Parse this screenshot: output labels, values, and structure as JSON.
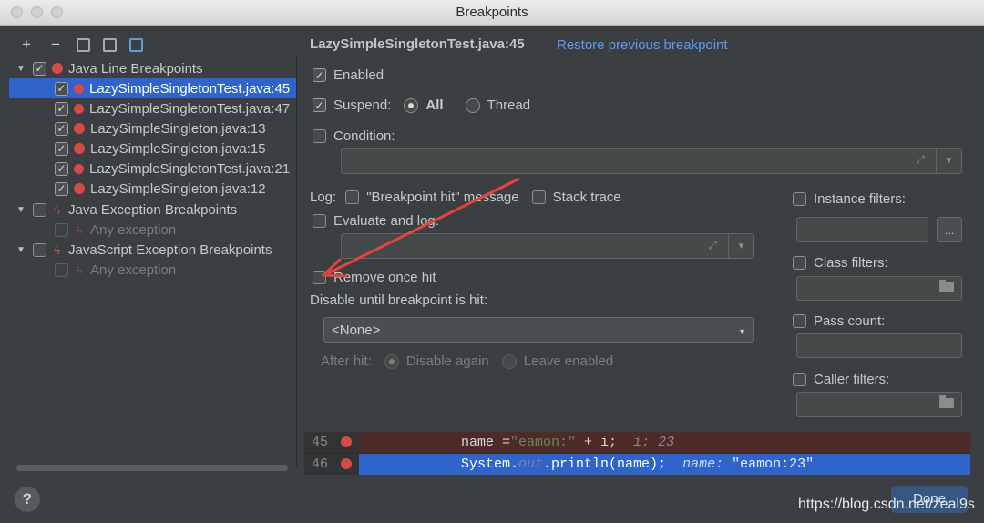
{
  "window": {
    "title": "Breakpoints"
  },
  "toolbar": {
    "add": "+",
    "remove": "−"
  },
  "tree": [
    {
      "label": "Java Line Breakpoints",
      "kind": "group",
      "checked": true,
      "icon": "red-dot-icon",
      "expanded": true
    },
    {
      "label": "LazySimpleSingletonTest.java:45",
      "kind": "item",
      "checked": true,
      "icon": "conditional-breakpoint-icon",
      "selected": true
    },
    {
      "label": "LazySimpleSingletonTest.java:47",
      "kind": "item",
      "checked": true,
      "icon": "breakpoint-question-icon"
    },
    {
      "label": "LazySimpleSingleton.java:13",
      "kind": "item",
      "checked": true,
      "icon": "red-dot-icon"
    },
    {
      "label": "LazySimpleSingleton.java:15",
      "kind": "item",
      "checked": true,
      "icon": "red-dot-icon"
    },
    {
      "label": "LazySimpleSingletonTest.java:21",
      "kind": "item",
      "checked": true,
      "icon": "conditional-breakpoint-icon"
    },
    {
      "label": "LazySimpleSingleton.java:12",
      "kind": "item",
      "checked": true,
      "icon": "red-dot-icon"
    },
    {
      "label": "Java Exception Breakpoints",
      "kind": "group",
      "checked": false,
      "icon": "lightning-icon",
      "expanded": true
    },
    {
      "label": "Any exception",
      "kind": "item-dim",
      "checked": false,
      "icon": "lightning-icon"
    },
    {
      "label": "JavaScript Exception Breakpoints",
      "kind": "group",
      "checked": false,
      "icon": "lightning-icon",
      "expanded": true
    },
    {
      "label": "Any exception",
      "kind": "item-dim",
      "checked": false,
      "icon": "lightning-icon"
    }
  ],
  "detail": {
    "header": "LazySimpleSingletonTest.java:45",
    "restore_link": "Restore previous breakpoint",
    "enabled": "Enabled",
    "suspend": "Suspend:",
    "suspend_all": "All",
    "suspend_thread": "Thread",
    "condition": "Condition:",
    "log": "Log:",
    "log_message": "\"Breakpoint hit\" message",
    "stack_trace": "Stack trace",
    "evaluate_log": "Evaluate and log:",
    "remove_once_hit": "Remove once hit",
    "disable_until": "Disable until breakpoint is hit:",
    "disable_select": "<None>",
    "after_hit": "After hit:",
    "disable_again": "Disable again",
    "leave_enabled": "Leave enabled",
    "instance_filters": "Instance filters:",
    "class_filters": "Class filters:",
    "pass_count": "Pass count:",
    "caller_filters": "Caller filters:",
    "more_button": "..."
  },
  "code": {
    "line1_number": "45",
    "line1_code": "name =",
    "line1_string": "\"eamon:\"",
    "line1_rest": " + i;",
    "line1_comment": "i: 23",
    "line2_number": "46",
    "line2_code_a": "System.",
    "line2_field": "out",
    "line2_code_b": ".println(name);",
    "line2_comment": "name: ",
    "line2_value": "\"eamon:23\""
  },
  "footer": {
    "help": "?",
    "done": "Done",
    "watermark": "https://blog.csdn.net/zeal9s"
  },
  "colors": {
    "accent": "#2f65ca",
    "link": "#589df6",
    "breakpoint": "#d74a45",
    "annotation_arrow": "#e0463d"
  }
}
